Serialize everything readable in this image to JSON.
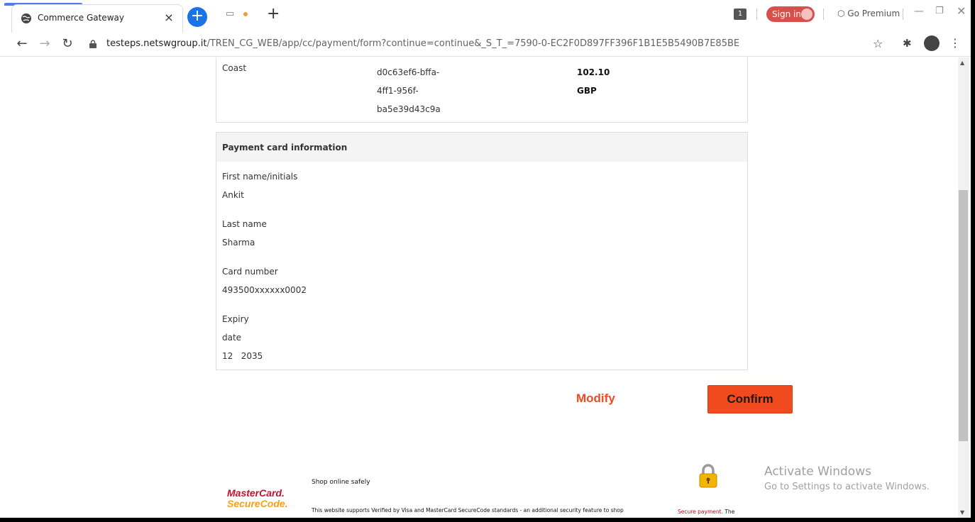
{
  "browser": {
    "tab_title": "Commerce Gateway",
    "tab_close": "×",
    "new_tab": "+",
    "tab_count": "1",
    "sign_in": "Sign in",
    "premium": "Go Premium",
    "url_host": "testeps.netswgroup.it",
    "url_path": "/TREN_CG_WEB/app/cc/payment/form?continue=continue&_S_T_=7590-0-EC2F0D897FF396F1B1E5B5490B7E85BE"
  },
  "order": {
    "name": "Coast",
    "id_lines": [
      "d0c63ef6-bffa-",
      "4ff1-956f-",
      "ba5e39d43c9a"
    ],
    "amount": "102.10",
    "currency": "GBP"
  },
  "card": {
    "heading": "Payment card information",
    "first_name_label": "First name/initials",
    "first_name": "Ankit",
    "last_name_label": "Last name",
    "last_name": "Sharma",
    "card_number_label": "Card number",
    "card_number": "493500xxxxxx0002",
    "expiry_label_1": "Expiry",
    "expiry_label_2": "date",
    "expiry_value": "12   2035"
  },
  "actions": {
    "modify": "Modify",
    "confirm": "Confirm"
  },
  "footer": {
    "logo_line1": "MasterCard.",
    "logo_line2": "SecureCode.",
    "shop_title": "Shop online safely",
    "shop_desc": "This website supports Verified by Visa and MasterCard SecureCode standards - an additional security feature to shop",
    "secure_red": "Secure payment.",
    "secure_rest": " The"
  },
  "watermark": {
    "title": "Activate Windows",
    "subtitle": "Go to Settings to activate Windows."
  },
  "colors": {
    "accent": "#f04a1e",
    "chrome_blue": "#1a73e8",
    "signin_red": "#d7514a"
  }
}
